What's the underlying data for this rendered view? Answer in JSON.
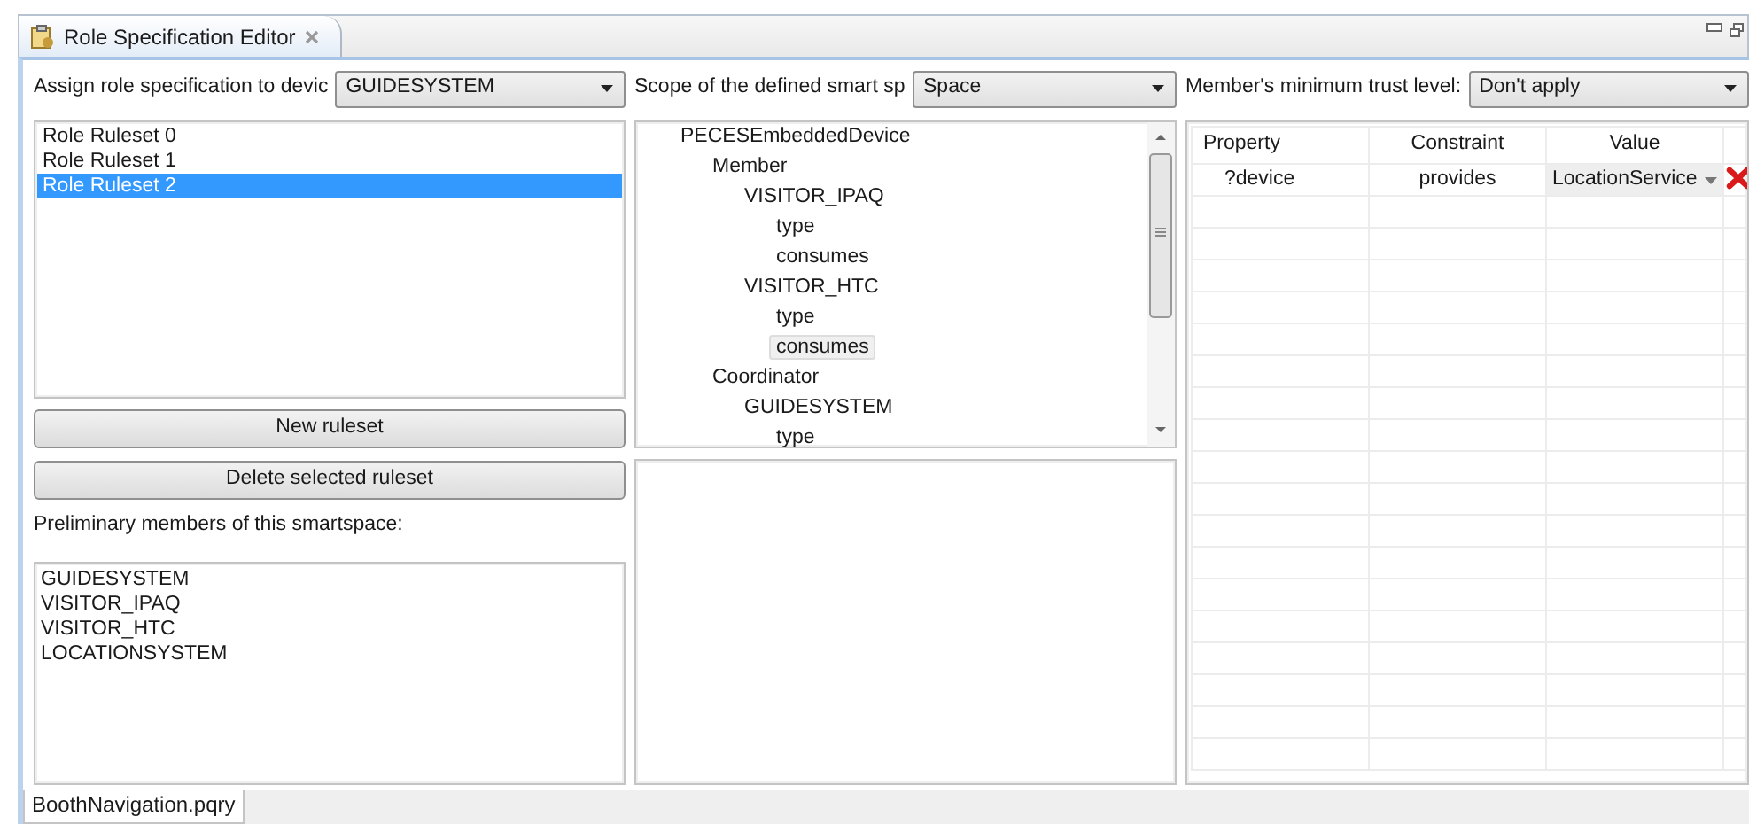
{
  "editor_tab": {
    "title": "Role Specification Editor",
    "selected": true
  },
  "device_select": {
    "label": "Assign role specification to devic",
    "value": "GUIDESYSTEM"
  },
  "scope_select": {
    "label": "Scope of the defined smart sp",
    "value": "Space"
  },
  "trust_select": {
    "label": "Member's minimum trust level:",
    "value": "Don't apply"
  },
  "rulesets": [
    {
      "label": "Role Ruleset 0",
      "selected": false
    },
    {
      "label": "Role Ruleset 1",
      "selected": false
    },
    {
      "label": "Role Ruleset 2",
      "selected": true
    }
  ],
  "buttons": [
    {
      "label": "New ruleset"
    },
    {
      "label": "Delete selected ruleset"
    }
  ],
  "members_label": "Preliminary members of this smartspace:",
  "members": [
    "GUIDESYSTEM",
    "VISITOR_IPAQ",
    "VISITOR_HTC",
    "LOCATIONSYSTEM"
  ],
  "tree": [
    {
      "label": "PECESEmbeddedDevice",
      "selected": false,
      "children": [
        {
          "label": "Member",
          "selected": false,
          "children": [
            {
              "label": "VISITOR_IPAQ",
              "selected": false,
              "children": [
                {
                  "label": "type",
                  "selected": false
                },
                {
                  "label": "consumes",
                  "selected": false
                }
              ]
            },
            {
              "label": "VISITOR_HTC",
              "selected": false,
              "children": [
                {
                  "label": "type",
                  "selected": false
                },
                {
                  "label": "consumes",
                  "selected": true
                }
              ]
            }
          ]
        },
        {
          "label": "Coordinator",
          "selected": false,
          "children": [
            {
              "label": "GUIDESYSTEM",
              "selected": false,
              "children": [
                {
                  "label": "type",
                  "selected": false
                }
              ]
            }
          ]
        }
      ]
    }
  ],
  "constraints_table": {
    "columns": [
      "Property",
      "Constraint",
      "Value"
    ],
    "rows": [
      {
        "property": "?device",
        "constraint": "provides",
        "value": "LocationService"
      }
    ]
  },
  "bottom_tab": {
    "label": "BoothNavigation.pqry",
    "selected": true
  }
}
